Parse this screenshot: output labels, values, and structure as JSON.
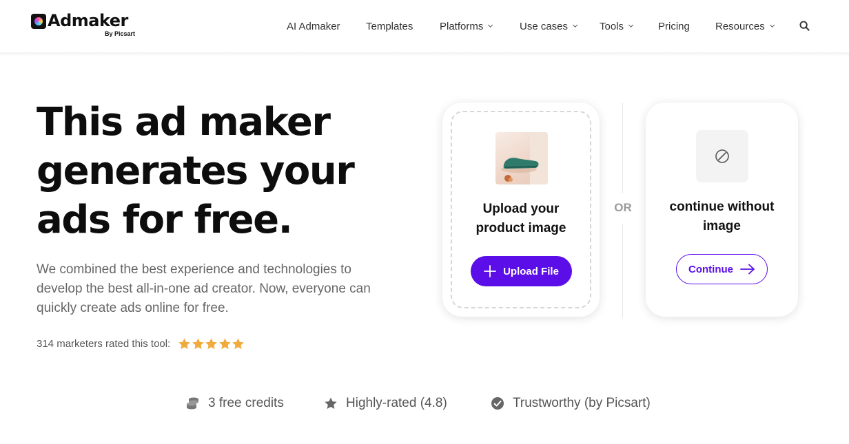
{
  "header": {
    "logo_text": "Admaker",
    "logo_sub": "By Picsart",
    "nav": [
      {
        "label": "AI Admaker",
        "has_dropdown": false
      },
      {
        "label": "Templates",
        "has_dropdown": false
      },
      {
        "label": "Platforms",
        "has_dropdown": true
      },
      {
        "label": "Use cases",
        "has_dropdown": true
      },
      {
        "label": "Tools",
        "has_dropdown": true
      },
      {
        "label": "Pricing",
        "has_dropdown": false
      },
      {
        "label": "Resources",
        "has_dropdown": true
      }
    ],
    "search_icon": "search-icon"
  },
  "hero": {
    "title_line1": "This ad maker",
    "title_line2": "generates your",
    "title_line3": "ads for free.",
    "description_line1": "We combined the best experience and technologies to",
    "description_line2": "develop the best all-in-one ad creator. Now, everyone can",
    "description_line3": "quickly create ads online for free.",
    "rating_text": "314 marketers rated this tool:",
    "rating_stars": 5
  },
  "upload_card": {
    "title_line1": "Upload your",
    "title_line2": "product image",
    "button_label": "Upload File",
    "button_icon": "plus-icon"
  },
  "separator": {
    "label": "OR"
  },
  "continue_card": {
    "title_line1": "continue without",
    "title_line2": "image",
    "placeholder_icon": "no-image-icon",
    "button_label": "Continue",
    "button_icon": "arrow-right-icon"
  },
  "features": [
    {
      "icon": "coins-icon",
      "label": "3 free credits"
    },
    {
      "icon": "star-icon",
      "label": "Highly-rated (4.8)"
    },
    {
      "icon": "check-circle-icon",
      "label": "Trustworthy (by Picsart)"
    }
  ],
  "colors": {
    "accent": "#5b0ee8",
    "star": "#f0ab3c",
    "text_dark": "#0d0d0d",
    "text_muted": "#666666"
  }
}
